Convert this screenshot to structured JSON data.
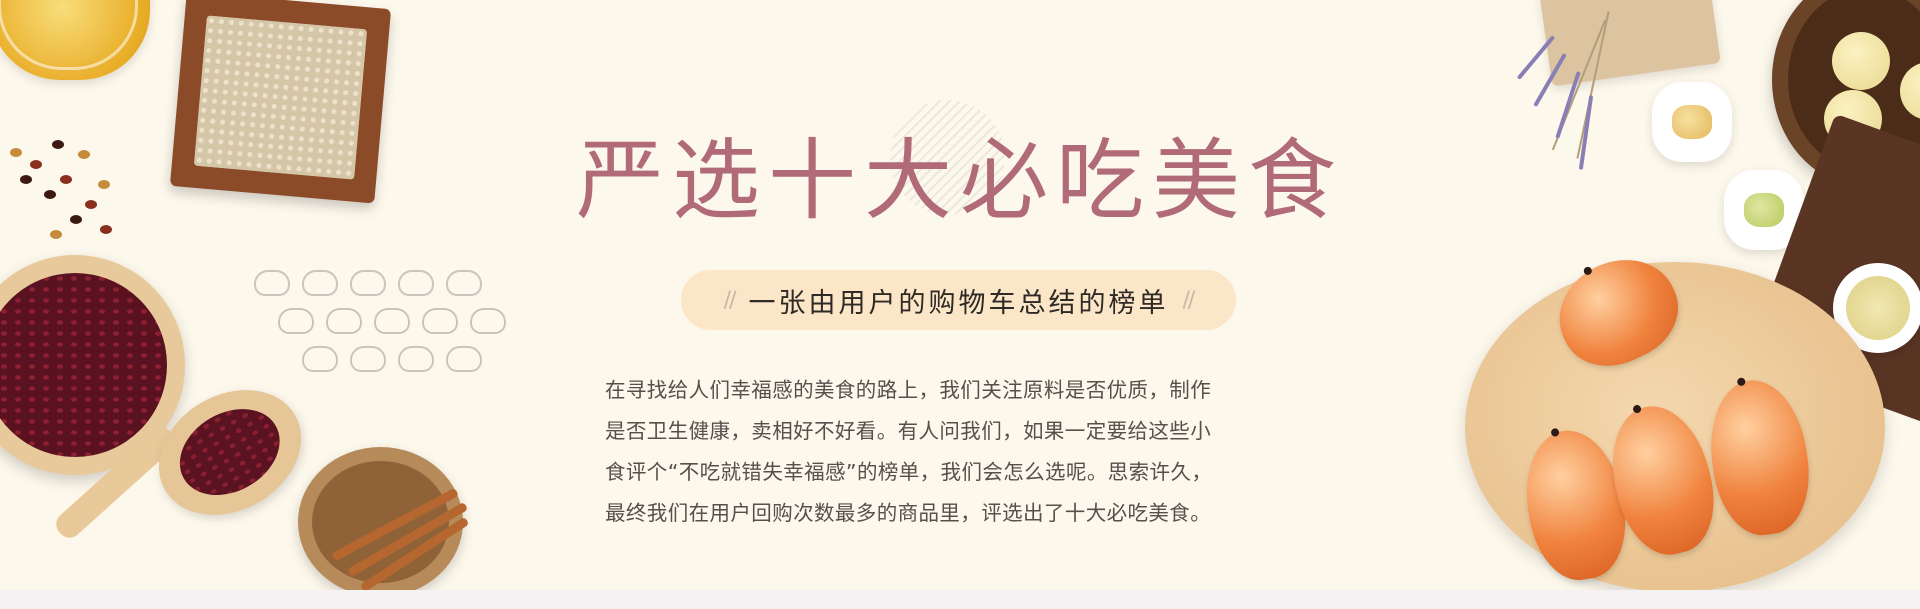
{
  "banner": {
    "title": "严选十大必吃美食",
    "subtitle_deco_left": "//",
    "subtitle": "一张由用户的购物车总结的榜单",
    "subtitle_deco_right": "//",
    "description_lines": [
      "在寻找给人们幸福感的美食的路上，我们关注原料是否优质，制作",
      "是否卫生健康，卖相好不好看。有人问我们，如果一定要给这些小",
      "食评个“不吃就错失幸福感”的榜单，我们会怎么选呢。思索许久，",
      "最终我们在用户回购次数最多的商品里，评选出了十大必吃美食。"
    ]
  },
  "decorations": {
    "left": [
      "honey-jar",
      "coix-seed-tray",
      "mixed-beans",
      "red-bean-bowl",
      "red-bean-scoop",
      "cinnamon-bowl"
    ],
    "right": [
      "lavender-board",
      "mochi-bowl",
      "jelly-dishes",
      "tea-cup",
      "dried-shrimp-plate"
    ],
    "bean_icon_rows": [
      5,
      5,
      4
    ]
  },
  "colors": {
    "background": "#fdf8ec",
    "title": "#b06a78",
    "pill": "#fbe6c8",
    "subtitle_text": "#2f2a26",
    "body_text": "#55504c"
  }
}
